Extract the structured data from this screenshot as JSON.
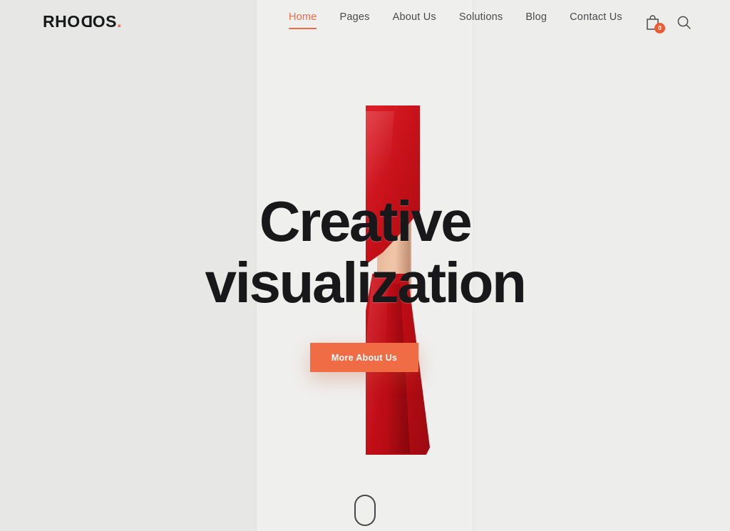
{
  "site": {
    "logo_text": "RHO",
    "logo_mirror_char": "D",
    "logo_tail": "OS",
    "logo_dot": ".",
    "logo_full": "RHODOS."
  },
  "header": {
    "nav": [
      {
        "label": "Home",
        "active": true
      },
      {
        "label": "Pages",
        "active": false
      },
      {
        "label": "About Us",
        "active": false
      },
      {
        "label": "Solutions",
        "active": false
      },
      {
        "label": "Blog",
        "active": false
      },
      {
        "label": "Contact Us",
        "active": false
      }
    ],
    "cart": {
      "icon": "shopping-bag-icon",
      "count": "0"
    },
    "search": {
      "icon": "search-icon"
    }
  },
  "hero": {
    "title_line1": "Creative",
    "title_line2": "visualization",
    "cta_label": "More About Us",
    "scroll_indicator": "scroll-mouse-icon"
  },
  "colors": {
    "accent": "#ef6c45",
    "cart_badge": "#ec5b32",
    "heading": "#18181a",
    "nav_text": "#4a4a4c",
    "bg_left": "#e7e7e6",
    "bg_mid": "#efefed",
    "bg_right": "#ededec",
    "dress_red": "#cc101a"
  }
}
